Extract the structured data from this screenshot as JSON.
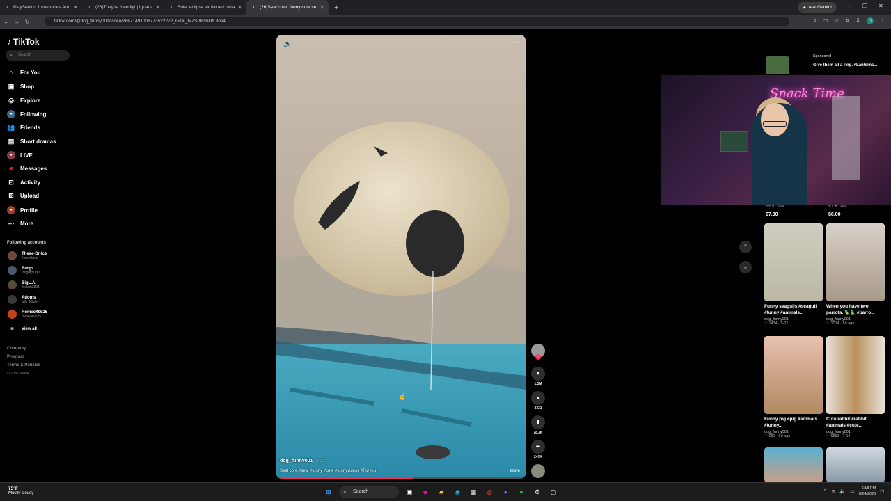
{
  "browser": {
    "tabs": [
      {
        "title": "PlayStation 1 memories Are w...",
        "icon": "tiktok-icon"
      },
      {
        "title": "(26)They're friendly! | Iguana | T...",
        "icon": "tiktok-icon"
      },
      {
        "title": "Solar eclipse explained: what h...",
        "icon": "tiktok-icon"
      },
      {
        "title": "(26)Seal core: funny cute se...",
        "icon": "tiktok-icon"
      }
    ],
    "gemini_label": "Ask Gemini",
    "url": "tiktok.com/@dog_funny001/video/7667149100877352227?_r=1&_t=ZS-98xnUtL8os4"
  },
  "sidebar": {
    "logo": "TikTok",
    "search_placeholder": "Search",
    "nav": [
      {
        "label": "For You",
        "icon": "home-icon"
      },
      {
        "label": "Shop",
        "icon": "shop-icon"
      },
      {
        "label": "Explore",
        "icon": "compass-icon"
      },
      {
        "label": "Following",
        "icon": "following-icon"
      },
      {
        "label": "Friends",
        "icon": "friends-icon"
      },
      {
        "label": "Short dramas",
        "icon": "drama-icon"
      },
      {
        "label": "LIVE",
        "icon": "live-icon"
      },
      {
        "label": "Messages",
        "icon": "messages-icon"
      },
      {
        "label": "Activity",
        "icon": "activity-icon"
      },
      {
        "label": "Upload",
        "icon": "upload-icon"
      },
      {
        "label": "Profile",
        "icon": "profile-icon"
      },
      {
        "label": "More",
        "icon": "more-icon"
      }
    ],
    "following_title": "Following accounts",
    "accounts": [
      {
        "name": "Theee-Dr-Ice",
        "handle": "theeedrice"
      },
      {
        "name": "Burgs",
        "handle": "tallguyburgz"
      },
      {
        "name": "BigL.A.",
        "handle": "theladi2891"
      },
      {
        "name": "Adonis",
        "handle": "a3o_k1eby"
      },
      {
        "name": "Romeo49525",
        "handle": "romeo49525"
      }
    ],
    "view_all": "View all",
    "footer": [
      "Company",
      "Program",
      "Terms & Policies",
      "© 2026 TikTok"
    ]
  },
  "video": {
    "username": "dog_funny001",
    "date": "· 7-27",
    "caption": "Seal core.#seal #funny #cute #funnyvideos #Foryou",
    "more": "more",
    "progress": 0.55
  },
  "actions": {
    "likes": "1.1M",
    "comments": "3331",
    "saves": "78.3K",
    "shares": "247K"
  },
  "right": {
    "sponsored_tag": "Sponsored",
    "sponsored_text": "Give them all a ring. #Lanterns...",
    "price_left": "$7.00",
    "price_right": "$6.00",
    "rating_left": "4.4 ★ · sold",
    "rating_right": "4.7 ★ · sold",
    "cards": [
      {
        "title": "Funny seagulls #seagull #funny #animals...",
        "user": "dog_funny001",
        "meta": "♡ 1434 · 5-21"
      },
      {
        "title": "When you have two parrots. 🦜🦜 #parro...",
        "user": "dog_funny001",
        "meta": "♡ 1074 · 5d ago"
      },
      {
        "title": "Funny pig #pig #animals #funny...",
        "user": "dog_funny001",
        "meta": "♡ 962 · 6d ago"
      },
      {
        "title": "Cute rabbit #rabbit #animals #cute...",
        "user": "dog_funny001",
        "meta": "♡ 6553 · 7-14"
      }
    ]
  },
  "stream": {
    "neon_text": "Snack Time"
  },
  "taskbar": {
    "temp": "75°F",
    "weather": "Mostly cloudy",
    "search": "Search",
    "time": "6:18 PM",
    "date": "8/24/2026"
  }
}
